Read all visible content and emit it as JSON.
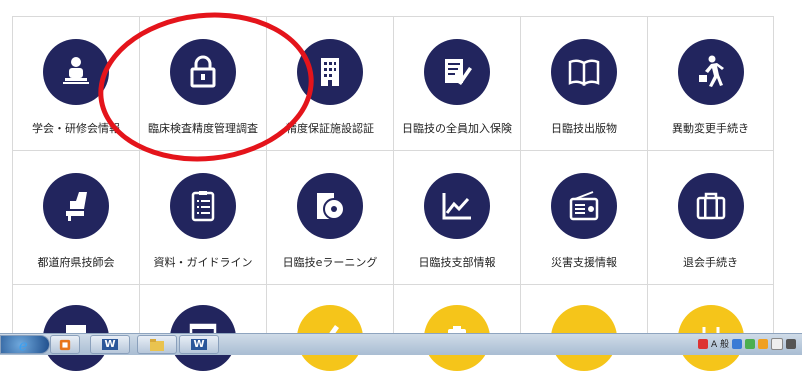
{
  "tiles_row1": [
    {
      "label": "学会・研修会情報",
      "icon": "lecture-podium-icon"
    },
    {
      "label": "臨床検査精度管理調査",
      "icon": "lock-icon"
    },
    {
      "label": "精度保証施設認証",
      "icon": "building-icon"
    },
    {
      "label": "日臨技の全員加入保険",
      "icon": "signed-document-icon"
    },
    {
      "label": "日臨技出版物",
      "icon": "open-book-icon"
    },
    {
      "label": "異動変更手続き",
      "icon": "walking-person-icon"
    }
  ],
  "tiles_row2": [
    {
      "label": "都道府県技師会",
      "icon": "seat-icon"
    },
    {
      "label": "資料・ガイドライン",
      "icon": "clipboard-list-icon"
    },
    {
      "label": "日臨技eラーニング",
      "icon": "cd-disc-icon"
    },
    {
      "label": "日臨技支部情報",
      "icon": "line-chart-icon"
    },
    {
      "label": "災害支援情報",
      "icon": "radio-icon"
    },
    {
      "label": "退会手続き",
      "icon": "briefcase-icon"
    }
  ],
  "tiles_row3_colors": [
    "#22255e",
    "#22255e",
    "#f5c51a",
    "#f5c51a",
    "#f5c51a",
    "#f5c51a"
  ],
  "annotation_color": "#e4141b",
  "taskbar": {
    "apps": [
      "ie-icon",
      "media-player-icon",
      "word-icon",
      "explorer-icon",
      "word-icon"
    ],
    "word_label": "W",
    "ime": "A 般"
  }
}
